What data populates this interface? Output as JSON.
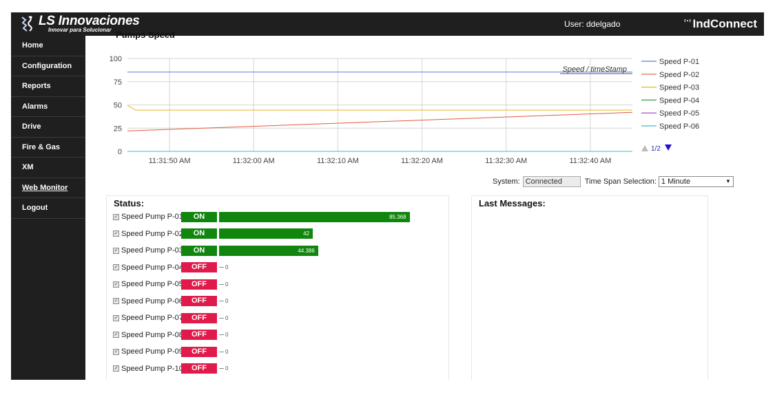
{
  "header": {
    "logo_name": "LS Innovaciones",
    "logo_tagline": "Innovar para Solucionar",
    "user_label": "User: ddelgado",
    "brand_name": "IndConnect"
  },
  "sidebar": {
    "items": [
      {
        "label": "Home"
      },
      {
        "label": "Configuration"
      },
      {
        "label": "Reports"
      },
      {
        "label": "Alarms"
      },
      {
        "label": "Drive"
      },
      {
        "label": "Fire & Gas"
      },
      {
        "label": "XM"
      },
      {
        "label": "Web Monitor"
      },
      {
        "label": "Logout"
      }
    ]
  },
  "chart_data": {
    "type": "line",
    "title": "Pumps Speed",
    "annotation": "Speed / timeStamp",
    "x": [
      "11:31:45",
      "11:31:46",
      "11:32:45"
    ],
    "xticks": [
      "11:31:50 AM",
      "11:32:00 AM",
      "11:32:10 AM",
      "11:32:20 AM",
      "11:32:30 AM",
      "11:32:40 AM"
    ],
    "yticks": [
      0,
      25,
      50,
      75,
      100
    ],
    "ylim": [
      0,
      100
    ],
    "grid": true,
    "legend_position": "right",
    "legend_page": "1/2",
    "series": [
      {
        "name": "Speed P-01",
        "color": "#5a7fdc",
        "values": [
          85.4,
          85.37,
          85.37
        ]
      },
      {
        "name": "Speed P-02",
        "color": "#e05a3c",
        "values": [
          22,
          22.3,
          42
        ]
      },
      {
        "name": "Speed P-03",
        "color": "#f0b020",
        "values": [
          49.5,
          44.4,
          44.4
        ]
      },
      {
        "name": "Speed P-04",
        "color": "#2aa04a",
        "values": [
          0,
          0,
          0
        ]
      },
      {
        "name": "Speed P-05",
        "color": "#9a3cc0",
        "values": [
          0,
          0,
          0
        ]
      },
      {
        "name": "Speed P-06",
        "color": "#40b8c8",
        "values": [
          0,
          0,
          0
        ]
      }
    ]
  },
  "system": {
    "label": "System:",
    "value": "Connected",
    "timespan_label": "Time Span Selection:",
    "timespan_value": "1 Minute"
  },
  "status": {
    "title": "Status:",
    "pumps": [
      {
        "name": "Speed Pump P-01",
        "state": "ON",
        "value": 85.368,
        "value_label": "85.368"
      },
      {
        "name": "Speed Pump P-02",
        "state": "ON",
        "value": 42,
        "value_label": "42"
      },
      {
        "name": "Speed Pump P-03",
        "state": "ON",
        "value": 44.386,
        "value_label": "44.386"
      },
      {
        "name": "Speed Pump P-04",
        "state": "OFF",
        "value": 0,
        "value_label": "0"
      },
      {
        "name": "Speed Pump P-05",
        "state": "OFF",
        "value": 0,
        "value_label": "0"
      },
      {
        "name": "Speed Pump P-06",
        "state": "OFF",
        "value": 0,
        "value_label": "0"
      },
      {
        "name": "Speed Pump P-07",
        "state": "OFF",
        "value": 0,
        "value_label": "0"
      },
      {
        "name": "Speed Pump P-08",
        "state": "OFF",
        "value": 0,
        "value_label": "0"
      },
      {
        "name": "Speed Pump P-09",
        "state": "OFF",
        "value": 0,
        "value_label": "0"
      },
      {
        "name": "Speed Pump P-10",
        "state": "OFF",
        "value": 0,
        "value_label": "0"
      }
    ]
  },
  "messages": {
    "title": "Last Messages:"
  }
}
